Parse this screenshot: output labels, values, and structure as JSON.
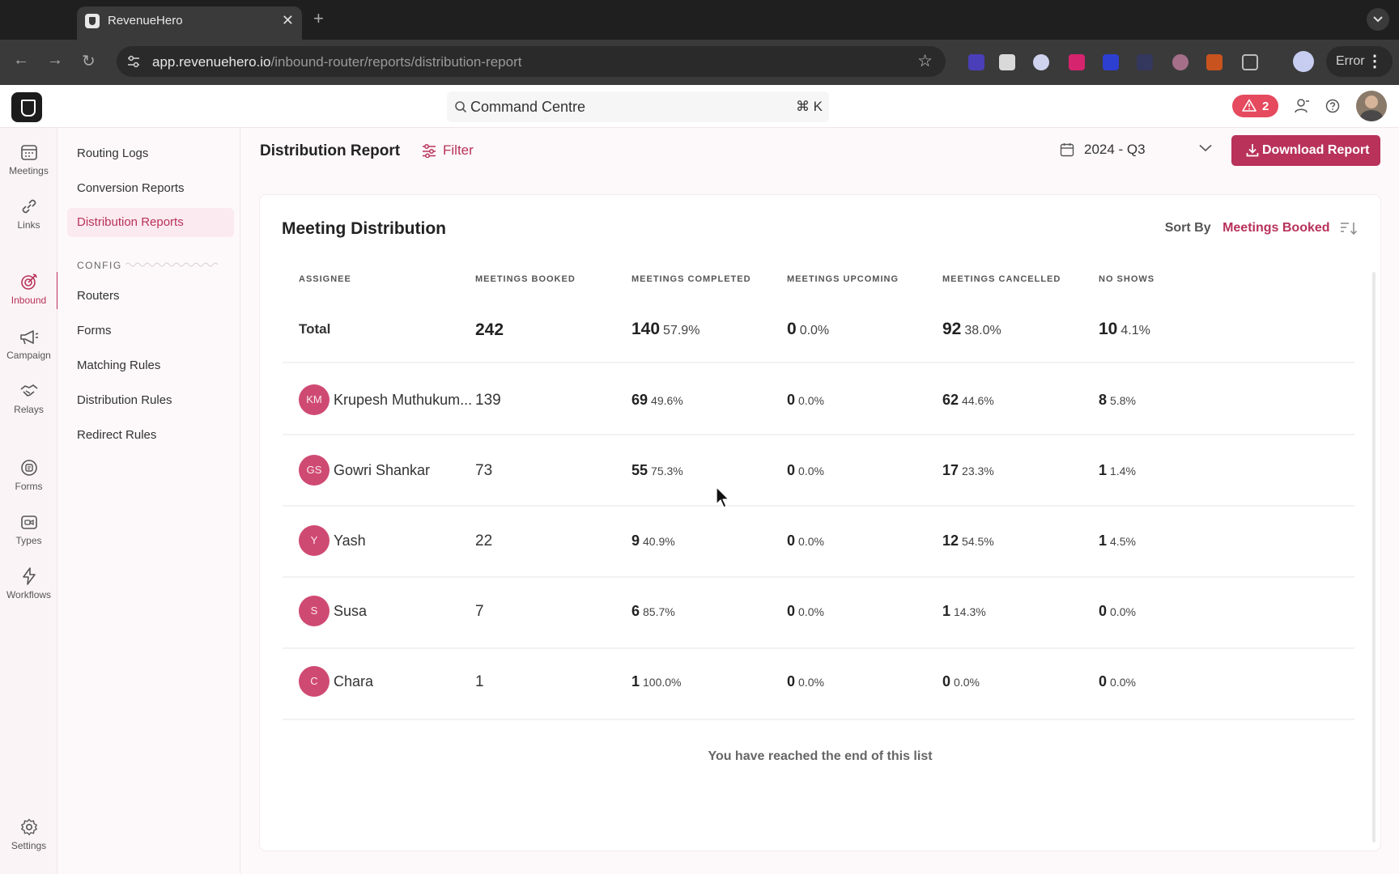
{
  "browser": {
    "tab_title": "RevenueHero",
    "url_host": "app.revenuehero.io",
    "url_path": "/inbound-router/reports/distribution-report",
    "error_label": "Error",
    "new_tab": "+",
    "close_tab": "✕"
  },
  "header": {
    "command_centre": "Command Centre",
    "command_shortcut": "⌘ K",
    "alert_count": "2"
  },
  "rail": {
    "items": [
      {
        "label": "Meetings",
        "icon": "calendar-icon"
      },
      {
        "label": "Links",
        "icon": "link-icon"
      },
      {
        "label": "Inbound",
        "icon": "target-icon"
      },
      {
        "label": "Campaign",
        "icon": "megaphone-icon"
      },
      {
        "label": "Relays",
        "icon": "handshake-icon"
      },
      {
        "label": "Forms",
        "icon": "form-icon"
      },
      {
        "label": "Types",
        "icon": "video-icon"
      },
      {
        "label": "Workflows",
        "icon": "lightning-icon"
      },
      {
        "label": "Settings",
        "icon": "gear-icon"
      }
    ]
  },
  "subnav": {
    "items": [
      "Routing Logs",
      "Conversion Reports",
      "Distribution Reports"
    ],
    "config_label": "CONFIG",
    "config_items": [
      "Routers",
      "Forms",
      "Matching Rules",
      "Distribution Rules",
      "Redirect Rules"
    ]
  },
  "page": {
    "title": "Distribution Report",
    "filter_label": "Filter",
    "quarter": "2024 - Q3",
    "download_label": "Download Report"
  },
  "card": {
    "title": "Meeting Distribution",
    "sort_label": "Sort By",
    "sort_value": "Meetings Booked",
    "columns": [
      "ASSIGNEE",
      "MEETINGS BOOKED",
      "MEETINGS COMPLETED",
      "MEETINGS UPCOMING",
      "MEETINGS CANCELLED",
      "NO SHOWS"
    ],
    "total": {
      "label": "Total",
      "booked": "242",
      "completed": "140",
      "completed_pct": "57.9%",
      "upcoming": "0",
      "upcoming_pct": "0.0%",
      "cancelled": "92",
      "cancelled_pct": "38.0%",
      "no_shows": "10",
      "no_shows_pct": "4.1%"
    },
    "rows": [
      {
        "initials": "KM",
        "name": "Krupesh Muthukum...",
        "booked": "139",
        "completed": "69",
        "completed_pct": "49.6%",
        "upcoming": "0",
        "upcoming_pct": "0.0%",
        "cancelled": "62",
        "cancelled_pct": "44.6%",
        "no_shows": "8",
        "no_shows_pct": "5.8%"
      },
      {
        "initials": "GS",
        "name": "Gowri Shankar",
        "booked": "73",
        "completed": "55",
        "completed_pct": "75.3%",
        "upcoming": "0",
        "upcoming_pct": "0.0%",
        "cancelled": "17",
        "cancelled_pct": "23.3%",
        "no_shows": "1",
        "no_shows_pct": "1.4%"
      },
      {
        "initials": "Y",
        "name": "Yash",
        "booked": "22",
        "completed": "9",
        "completed_pct": "40.9%",
        "upcoming": "0",
        "upcoming_pct": "0.0%",
        "cancelled": "12",
        "cancelled_pct": "54.5%",
        "no_shows": "1",
        "no_shows_pct": "4.5%"
      },
      {
        "initials": "S",
        "name": "Susa",
        "booked": "7",
        "completed": "6",
        "completed_pct": "85.7%",
        "upcoming": "0",
        "upcoming_pct": "0.0%",
        "cancelled": "1",
        "cancelled_pct": "14.3%",
        "no_shows": "0",
        "no_shows_pct": "0.0%"
      },
      {
        "initials": "C",
        "name": "Chara",
        "booked": "1",
        "completed": "1",
        "completed_pct": "100.0%",
        "upcoming": "0",
        "upcoming_pct": "0.0%",
        "cancelled": "0",
        "cancelled_pct": "0.0%",
        "no_shows": "0",
        "no_shows_pct": "0.0%"
      }
    ],
    "end_note": "You have reached the end of this list"
  },
  "colors": {
    "accent": "#b8325a",
    "avatar": "#cf4a72",
    "alert": "#e54a5e"
  }
}
